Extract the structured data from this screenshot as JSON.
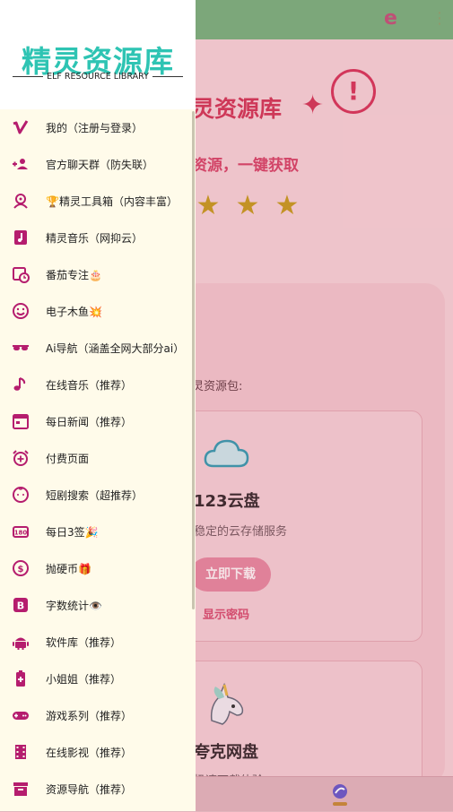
{
  "colors": {
    "drawer_bg": "#fffbea",
    "logo": "#2ec4b3",
    "icon": "#b51d6e",
    "accent": "#d4385a",
    "topbar": "#7bb07e"
  },
  "drawer": {
    "logo_title": "精灵资源库",
    "logo_subtitle": "ELF RESOURCE LIBRARY",
    "items": [
      {
        "label": "我的（注册与登录）",
        "icon": "vimeo-icon"
      },
      {
        "label": "官方聊天群（防失联）",
        "icon": "group-add-icon"
      },
      {
        "label": "🏆精灵工具箱（内容丰富）",
        "icon": "toolbox-icon"
      },
      {
        "label": "精灵音乐（网抑云）",
        "icon": "music-note-icon"
      },
      {
        "label": "番茄专注🎂",
        "icon": "calendar-clock-icon"
      },
      {
        "label": "电子木鱼💥",
        "icon": "emoji-icon"
      },
      {
        "label": "Ai导航（涵盖全网大部分ai）",
        "icon": "sunglasses-icon"
      },
      {
        "label": "在线音乐（推荐）",
        "icon": "music-icon"
      },
      {
        "label": "每日新闻（推荐）",
        "icon": "calendar-icon"
      },
      {
        "label": "付费页面",
        "icon": "alarm-icon"
      },
      {
        "label": "短剧搜索（超推荐）",
        "icon": "baby-face-icon"
      },
      {
        "label": "每日3签🎉",
        "icon": "counter-icon"
      },
      {
        "label": "抛硬币🎁",
        "icon": "coin-icon"
      },
      {
        "label": "字数统计👁️",
        "icon": "blogger-icon"
      },
      {
        "label": "软件库（推荐）",
        "icon": "android-icon"
      },
      {
        "label": "小姐姐（推荐）",
        "icon": "battery-plus-icon"
      },
      {
        "label": "游戏系列（推荐）",
        "icon": "gamepad-icon"
      },
      {
        "label": "在线影视（推荐）",
        "icon": "film-icon"
      },
      {
        "label": "资源导航（推荐）",
        "icon": "archive-icon"
      }
    ]
  },
  "main": {
    "hero_title": "灵资源库",
    "hero_subtitle": "资源，一键获取",
    "section_label": "灵资源包:",
    "card1": {
      "title": "123云盘",
      "desc": "稳定的云存储服务",
      "button": "立即下载",
      "link": "显示密码"
    },
    "card2": {
      "title": "夸克网盘",
      "desc": "极速下载体验"
    }
  }
}
